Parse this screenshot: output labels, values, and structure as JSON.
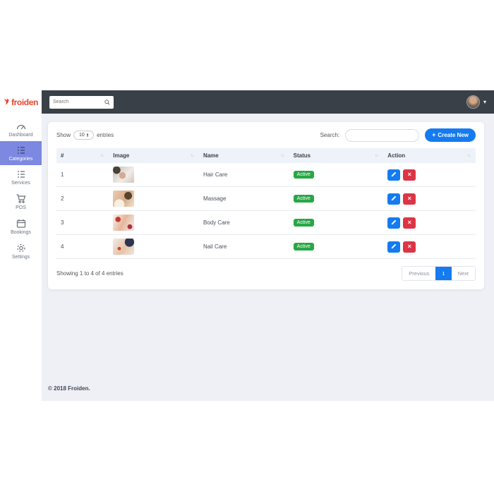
{
  "logo": {
    "brand": "froiden"
  },
  "topbar": {
    "search_placeholder": "Search"
  },
  "sidebar": {
    "items": [
      {
        "label": "Dashboard",
        "active": false
      },
      {
        "label": "Categories",
        "active": true
      },
      {
        "label": "Services",
        "active": false
      },
      {
        "label": "POS",
        "active": false
      },
      {
        "label": "Bookings",
        "active": false
      },
      {
        "label": "Settings",
        "active": false
      }
    ]
  },
  "toolbar": {
    "show_label": "Show",
    "page_size": "10",
    "entries_label": "entries",
    "search_label": "Search:",
    "create_button_label": "Create New"
  },
  "table": {
    "columns": [
      {
        "label": "#"
      },
      {
        "label": "Image"
      },
      {
        "label": "Name"
      },
      {
        "label": "Status"
      },
      {
        "label": "Action"
      }
    ],
    "rows": [
      {
        "num": "1",
        "image": "hair-care-photo",
        "name": "Hair Care",
        "status": "Active"
      },
      {
        "num": "2",
        "image": "massage-photo",
        "name": "Massage",
        "status": "Active"
      },
      {
        "num": "3",
        "image": "body-care-photo",
        "name": "Body Care",
        "status": "Active"
      },
      {
        "num": "4",
        "image": "nail-care-photo",
        "name": "Nail Care",
        "status": "Active"
      }
    ]
  },
  "summary": "Showing 1 to 4 of 4 entries",
  "pagination": {
    "previous": "Previous",
    "page": "1",
    "next": "Next"
  },
  "footer": {
    "copyright": "© 2018 Froiden."
  },
  "colors": {
    "accent_blue": "#147bf0",
    "active_green": "#28a745",
    "danger_red": "#dc3545",
    "sidebar_active": "#7d88e1",
    "topbar_dark": "#3a4047",
    "brand_red": "#e8432d"
  }
}
